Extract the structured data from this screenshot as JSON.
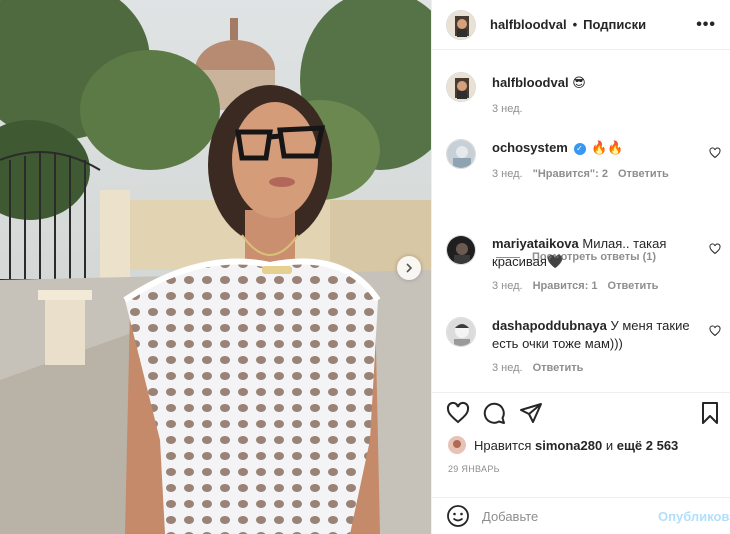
{
  "post": {
    "author": "halfbloodval",
    "follow_label": "Подписки",
    "more_icon": "more-horizontal-icon",
    "next_icon": "chevron-right-icon"
  },
  "caption": {
    "username": "halfbloodval",
    "text": "😎",
    "time": "3 нед."
  },
  "comments": [
    {
      "username": "ochosystem",
      "verified": true,
      "text": "🔥🔥",
      "time": "3 нед.",
      "likes": "\"Нравится\": 2",
      "reply": "Ответить"
    },
    {
      "username": "mariyataikova",
      "verified": false,
      "text": "Милая.. такая красивая🖤",
      "time": "3 нед.",
      "likes": "Нравится: 1",
      "reply": "Ответить"
    },
    {
      "username": "dashapoddubnaya",
      "verified": false,
      "text": "У меня такие есть очки тоже мам)))",
      "time": "3 нед.",
      "likes": "",
      "reply": "Ответить"
    }
  ],
  "view_replies": "Посмотреть ответы (1)",
  "likes_line": {
    "prefix": "Нравится",
    "user": "simona280",
    "middle": "и",
    "count": "ещё 2 563"
  },
  "date": "29 ЯНВАРЬ",
  "add_comment": {
    "placeholder": "Добавьте",
    "post_label": "Опубликовать"
  },
  "colors": {
    "accent": "#0095f6",
    "post_disabled": "#b2dffc",
    "muted": "#8e8e8e"
  }
}
